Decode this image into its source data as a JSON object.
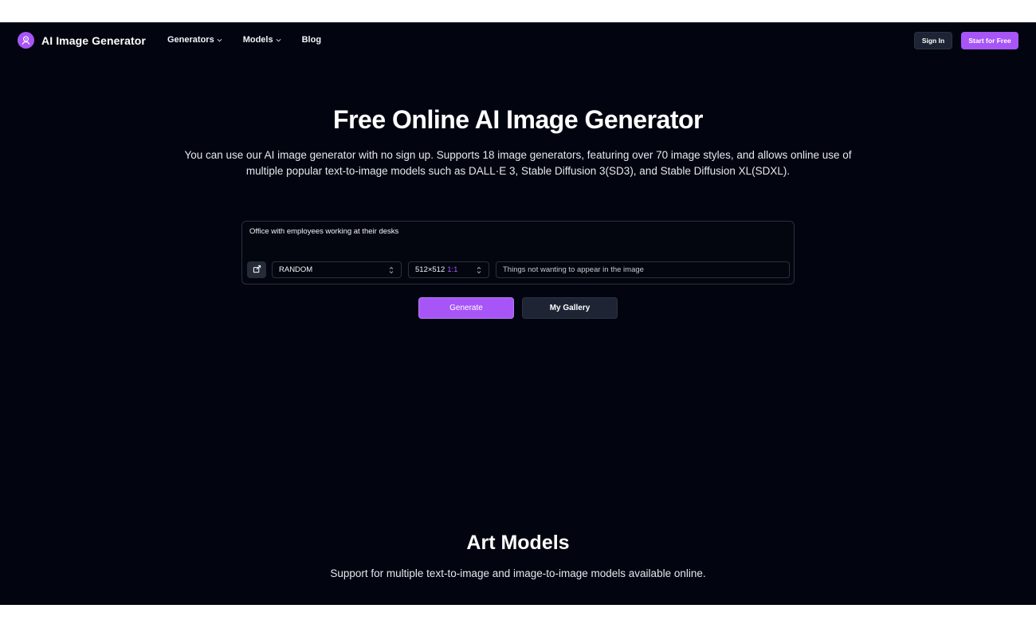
{
  "brand": {
    "name": "AI Image Generator",
    "accent": "#a855f7",
    "background": "#020510"
  },
  "nav": {
    "items": [
      {
        "label": "Generators",
        "dropdown": true
      },
      {
        "label": "Models",
        "dropdown": true
      },
      {
        "label": "Blog",
        "dropdown": false
      }
    ]
  },
  "header": {
    "sign_in_label": "Sign In",
    "start_label": "Start for Free"
  },
  "hero": {
    "title": "Free Online AI Image Generator",
    "subtitle": "You can use our AI image generator with no sign up. Supports 18 image generators, featuring over 70 image styles, and allows online use of multiple popular text-to-image models such as DALL·E 3, Stable Diffusion 3(SD3), and Stable Diffusion XL(SDXL)."
  },
  "prompt": {
    "value": "Office with employees working at their desks",
    "style_select": "RANDOM",
    "size_select": "512×512",
    "ratio": "1:1",
    "negative_placeholder": "Things not wanting to appear in the image"
  },
  "actions": {
    "generate_label": "Generate",
    "gallery_label": "My Gallery"
  },
  "art_models": {
    "title": "Art Models",
    "subtitle": "Support for multiple text-to-image and image-to-image models available online."
  }
}
